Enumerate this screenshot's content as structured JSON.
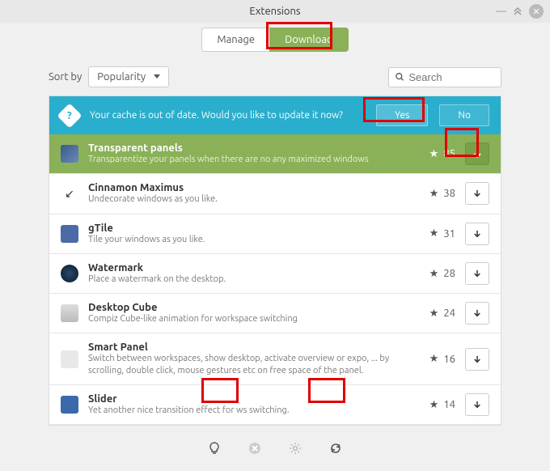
{
  "window": {
    "title": "Extensions"
  },
  "tabs": {
    "manage": "Manage",
    "download": "Download"
  },
  "sort": {
    "label": "Sort by",
    "value": "Popularity"
  },
  "search": {
    "placeholder": "Search"
  },
  "banner": {
    "msg": "Your cache is out of date. Would you like to update it now?",
    "yes": "Yes",
    "no": "No"
  },
  "items": [
    {
      "name": "Transparent panels",
      "desc": "Transparentize your panels when there are no any maximized windows",
      "stars": "85"
    },
    {
      "name": "Cinnamon Maximus",
      "desc": "Undecorate windows as you like.",
      "stars": "38"
    },
    {
      "name": "gTile",
      "desc": "Tile your windows as you like.",
      "stars": "31"
    },
    {
      "name": "Watermark",
      "desc": "Place a watermark on the desktop.",
      "stars": "28"
    },
    {
      "name": "Desktop Cube",
      "desc": "Compiz Cube-like animation for workspace switching",
      "stars": "24"
    },
    {
      "name": "Smart Panel",
      "desc": "Switch between workspaces, show desktop, activate overview or expo, ... by scrolling, double click, mouse gestures etc on free space of the panel.",
      "stars": "16"
    },
    {
      "name": "Slider",
      "desc": "Yet another nice transition effect for ws switching.",
      "stars": "14"
    }
  ]
}
